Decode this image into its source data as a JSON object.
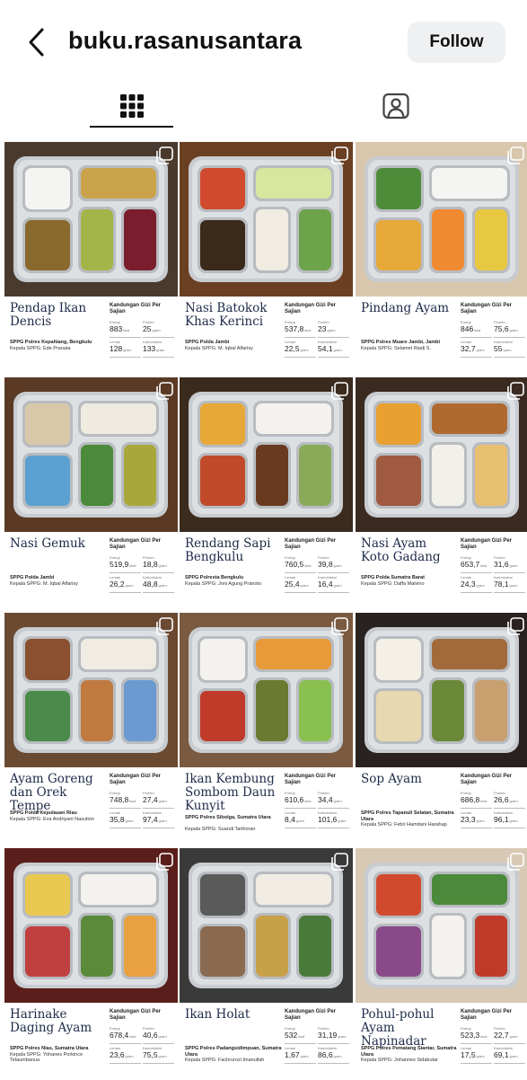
{
  "header": {
    "handle": "buku.rasanusantara",
    "follow_label": "Follow"
  },
  "icons": {
    "back": "chevron-left-icon",
    "grid": "grid-icon",
    "tagged": "tagged-person-icon",
    "multi": "multiple-images-icon"
  },
  "nutrition_header": "Kandungan Gizi Per Sajian",
  "labels": {
    "energi": "Energi",
    "protein": "Protein",
    "lemak": "Lemak",
    "karbo": "Karbohidrat",
    "kkal": "kkal",
    "gram": "gram"
  },
  "posts": [
    {
      "title": "Pendap Ikan Dencis",
      "energi": "883",
      "protein": "25",
      "lemak": "128",
      "karbo": "133",
      "sppg": "SPPG Polres Kepahiang, Bengkulu",
      "kepala": "Kepala SPPG: Ede Pranata"
    },
    {
      "title": "Nasi Batokok Khas Kerinci",
      "energi": "537,8",
      "protein": "23",
      "lemak": "22,5",
      "karbo": "54,1",
      "sppg": "SPPG Polda Jambi",
      "kepala": "Kepala SPPG: M. Iqbal Alfarisy"
    },
    {
      "title": "Pindang Ayam",
      "energi": "846",
      "protein": "75,6",
      "lemak": "32,7",
      "karbo": "55",
      "sppg": "SPPG Polres Muaro Jambi, Jambi",
      "kepala": "Kepala SPPG: Selamet Riadi S."
    },
    {
      "title": "Nasi Gemuk",
      "energi": "519,9",
      "protein": "18,8",
      "lemak": "26,2",
      "karbo": "48,8",
      "sppg": "SPPG Polda Jambi",
      "kepala": "Kepala SPPG: M. Iqbal Alfarisy"
    },
    {
      "title": "Rendang Sapi Bengkulu",
      "energi": "760,5",
      "protein": "39,8",
      "lemak": "25,4",
      "karbo": "16,4",
      "sppg": "SPPG Polresta Bengkulu",
      "kepala": "Kepala SPPG: Joni Agung Pranoto"
    },
    {
      "title": "Nasi Ayam Koto Gadang",
      "energi": "653,7",
      "protein": "31,6",
      "lemak": "24,3",
      "karbo": "78,1",
      "sppg": "SPPG Polda Sumatra Barat",
      "kepala": "Kepala SPPG: Daffa Malvino"
    },
    {
      "title": "Ayam Goreng dan Orek Tempe",
      "energi": "748,8",
      "protein": "27,4",
      "lemak": "35,8",
      "karbo": "97,4",
      "sppg": "SPPG Polda Kepulauan Riau",
      "kepala": "Kepala SPPG: Eva Andriyani Nasution"
    },
    {
      "title": "Ikan Kembung Sombom Daun Kunyit",
      "energi": "610,6",
      "protein": "34,4",
      "lemak": "8,4",
      "karbo": "101,6",
      "sppg": "SPPG Polres Sibolga, Sumatra Utara",
      "kepala": "Kepala SPPG: Suandi Tarihoran"
    },
    {
      "title": "Sop Ayam",
      "energi": "686,8",
      "protein": "26,6",
      "lemak": "23,3",
      "karbo": "96,1",
      "sppg": "SPPG Polres Tapanuli Selatan, Sumatra Utara",
      "kepala": "Kepala SPPG: Febri Hamdani Harahap"
    },
    {
      "title": "Harinake Daging Ayam",
      "energi": "678,4",
      "protein": "40,6",
      "lemak": "23,6",
      "karbo": "75,5",
      "sppg": "SPPG Polres Nias, Sumatra Utara",
      "kepala": "Kepala SPPG: Yohanes Porkince Telaumbanua"
    },
    {
      "title": "Ikan Holat",
      "energi": "532",
      "protein": "31,19",
      "lemak": "1,67",
      "karbo": "86,6",
      "sppg": "SPPG Polres Padangsidimpuan, Sumatra Utara",
      "kepala": "Kepala SPPG: Fachrurozi Imanullah"
    },
    {
      "title": "Pohul-pohul Ayam Napinadar",
      "energi": "523,3",
      "protein": "22,7",
      "lemak": "17,5",
      "karbo": "69,1",
      "sppg": "SPPG Polres Pematang Siantar, Sumatra Utara",
      "kepala": "Kepala SPPG: Johannes Sidabutar"
    }
  ]
}
